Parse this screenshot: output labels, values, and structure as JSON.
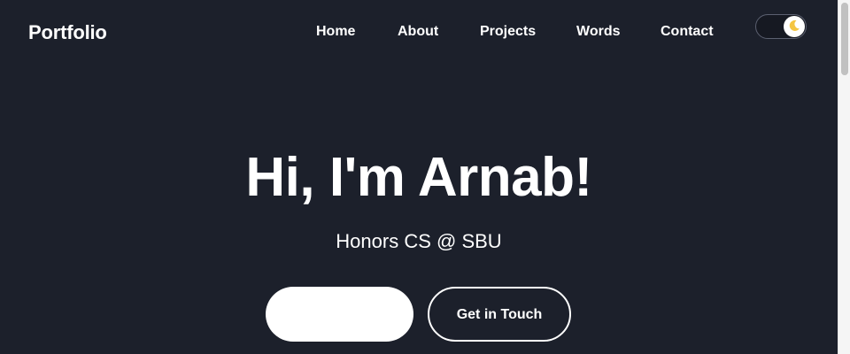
{
  "header": {
    "brand": "Portfolio",
    "nav": [
      {
        "label": "Home"
      },
      {
        "label": "About"
      },
      {
        "label": "Projects"
      },
      {
        "label": "Words"
      },
      {
        "label": "Contact"
      }
    ],
    "theme_toggle": {
      "icon": "moon-icon",
      "state": "dark"
    }
  },
  "hero": {
    "title": "Hi, I'm Arnab!",
    "subtitle": "Honors CS @ SBU",
    "primary_button_label": "",
    "secondary_button_label": "Get in Touch"
  },
  "colors": {
    "background": "#1c202b",
    "text": "#ffffff",
    "toggle_track": "#161922",
    "moon": "#f4c542"
  }
}
